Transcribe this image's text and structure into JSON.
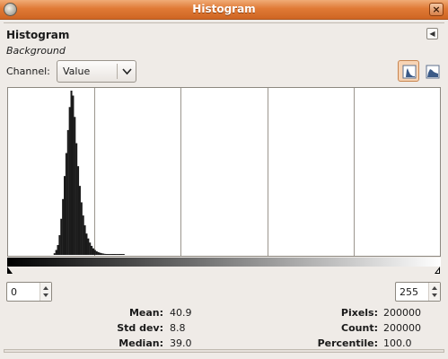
{
  "window": {
    "title": "Histogram"
  },
  "panel": {
    "heading": "Histogram",
    "subheading": "Background"
  },
  "channel": {
    "label": "Channel:",
    "value": "Value"
  },
  "range": {
    "low": "0",
    "high": "255"
  },
  "stats": {
    "mean_label": "Mean:",
    "mean": "40.9",
    "stddev_label": "Std dev:",
    "stddev": "8.8",
    "median_label": "Median:",
    "median": "39.0",
    "pixels_label": "Pixels:",
    "pixels": "200000",
    "count_label": "Count:",
    "count": "200000",
    "percentile_label": "Percentile:",
    "percentile": "100.0"
  },
  "icons": {
    "app": "gimp-icon",
    "close": "close-icon",
    "menu": "panel-menu-icon",
    "dropdown": "chevron-down-icon",
    "linear": "linear-histogram-icon",
    "log": "log-histogram-icon"
  },
  "colors": {
    "titlebar": "#e07a36",
    "histogram_fill": "#1a1a1a",
    "selected_button": "#f7d4b5"
  },
  "chart_data": {
    "type": "bar",
    "x_range": [
      0,
      255
    ],
    "bins": [
      [
        27,
        0.01
      ],
      [
        28,
        0.03
      ],
      [
        29,
        0.06
      ],
      [
        30,
        0.12
      ],
      [
        31,
        0.22
      ],
      [
        32,
        0.34
      ],
      [
        33,
        0.48
      ],
      [
        34,
        0.62
      ],
      [
        35,
        0.76
      ],
      [
        36,
        0.9
      ],
      [
        37,
        1.0
      ],
      [
        38,
        0.97
      ],
      [
        39,
        0.84
      ],
      [
        40,
        0.68
      ],
      [
        41,
        0.54
      ],
      [
        42,
        0.42
      ],
      [
        43,
        0.32
      ],
      [
        44,
        0.24
      ],
      [
        45,
        0.18
      ],
      [
        46,
        0.13
      ],
      [
        47,
        0.1
      ],
      [
        48,
        0.075
      ],
      [
        49,
        0.055
      ],
      [
        50,
        0.04
      ],
      [
        51,
        0.03
      ],
      [
        52,
        0.022
      ],
      [
        53,
        0.017
      ],
      [
        54,
        0.013
      ],
      [
        55,
        0.01
      ],
      [
        56,
        0.008
      ],
      [
        57,
        0.006
      ],
      [
        58,
        0.005
      ],
      [
        59,
        0.004
      ],
      [
        60,
        0.003
      ],
      [
        61,
        0.003
      ],
      [
        62,
        0.002
      ],
      [
        63,
        0.002
      ],
      [
        64,
        0.002
      ],
      [
        65,
        0.001
      ],
      [
        66,
        0.001
      ],
      [
        67,
        0.001
      ],
      [
        68,
        0.001
      ]
    ],
    "grid_divisions": 5,
    "scale": "linear"
  }
}
